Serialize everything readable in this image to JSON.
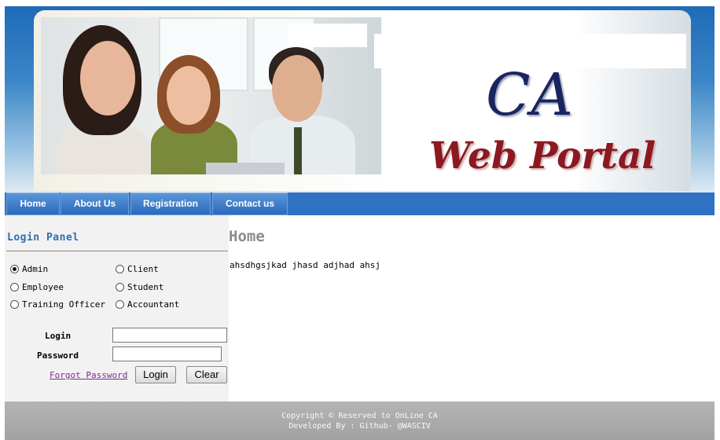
{
  "banner": {
    "logo_line1": "CA",
    "logo_line2": "Web Portal"
  },
  "nav": {
    "items": [
      {
        "label": "Home"
      },
      {
        "label": "About Us"
      },
      {
        "label": "Registration"
      },
      {
        "label": "Contact us"
      }
    ]
  },
  "login_panel": {
    "title": "Login Panel",
    "roles": [
      {
        "label": "Admin",
        "selected": true
      },
      {
        "label": "Client",
        "selected": false
      },
      {
        "label": "Employee",
        "selected": false
      },
      {
        "label": "Student",
        "selected": false
      },
      {
        "label": "Training Officer",
        "selected": false
      },
      {
        "label": "Accountant",
        "selected": false
      }
    ],
    "login_label": "Login",
    "password_label": "Password",
    "login_value": "",
    "password_value": "",
    "forgot_link": "Forgot Password",
    "login_button": "Login",
    "clear_button": "Clear"
  },
  "main": {
    "title": "Home",
    "text": "ahsdhgsjkad jhasd adjhad ahsj"
  },
  "footer": {
    "line1": "Copyright © Reserved to OnLine CA",
    "line2": "Developed By : Github- @WASCIV"
  },
  "colors": {
    "nav_blue": "#2f72c4",
    "title_blue": "#2d6fb3",
    "logo_navy": "#1a2560",
    "logo_red": "#8c1820",
    "footer_gray": "#a8a8a8"
  }
}
